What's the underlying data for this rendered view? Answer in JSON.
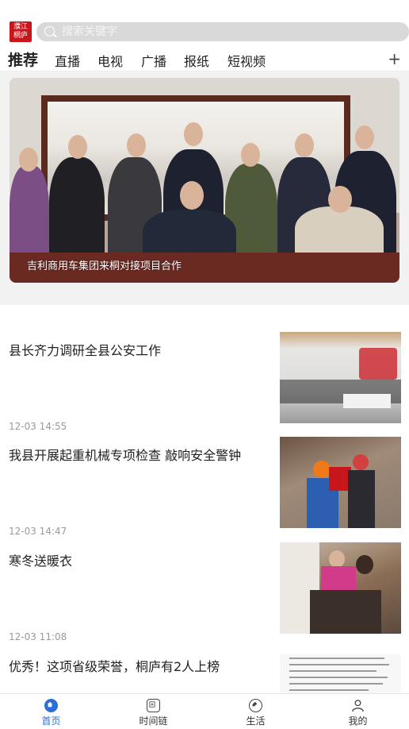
{
  "header": {
    "logo_text": "濮江桐庐",
    "search_placeholder": "搜索关键字"
  },
  "tabs": [
    {
      "label": "推荐",
      "active": true
    },
    {
      "label": "直播",
      "active": false
    },
    {
      "label": "电视",
      "active": false
    },
    {
      "label": "广播",
      "active": false
    },
    {
      "label": "报纸",
      "active": false
    },
    {
      "label": "短视频",
      "active": false
    }
  ],
  "tabs_add_label": "+",
  "banner": {
    "caption": "吉利商用车集团来桐对接项目合作"
  },
  "news": [
    {
      "title": "县长齐力调研全县公安工作",
      "time": "12-03 14:55"
    },
    {
      "title": "我县开展起重机械专项检查  敲响安全警钟",
      "time": "12-03 14:47"
    },
    {
      "title": "寒冬送暖衣",
      "time": "12-03 11:08"
    },
    {
      "title": "优秀！这项省级荣誉，桐庐有2人上榜",
      "time": ""
    }
  ],
  "bottom_nav": [
    {
      "label": "首页",
      "icon": "home-icon",
      "active": true
    },
    {
      "label": "时间链",
      "icon": "timeline-icon",
      "active": false
    },
    {
      "label": "生活",
      "icon": "tag-icon",
      "active": false
    },
    {
      "label": "我的",
      "icon": "user-icon",
      "active": false
    }
  ],
  "colors": {
    "accent_red": "#c8161d",
    "active_blue": "#2a6fd6",
    "search_bg": "#d9d9d9"
  }
}
